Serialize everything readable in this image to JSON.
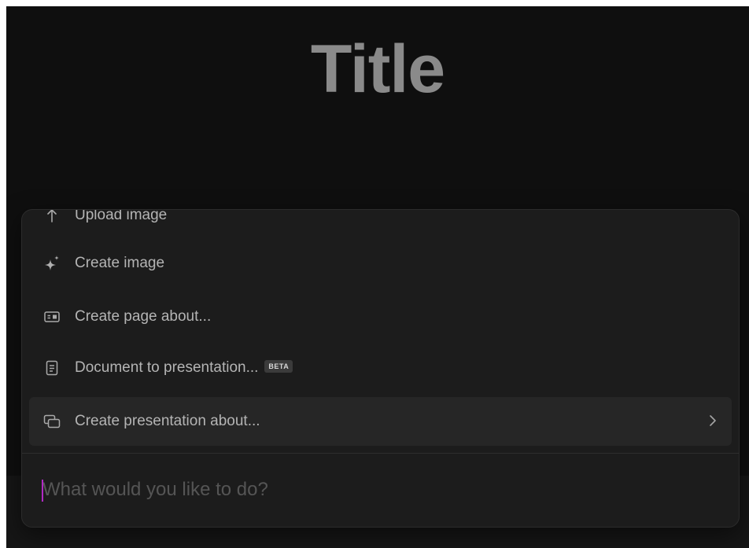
{
  "page": {
    "title": "Title"
  },
  "menu": {
    "items": [
      {
        "label": "Upload image",
        "icon": "upload-icon"
      },
      {
        "label": "Create image",
        "icon": "sparkle-icon"
      },
      {
        "label": "Create page about...",
        "icon": "page-card-icon"
      },
      {
        "label": "Document to presentation...",
        "icon": "document-icon",
        "badge": "BETA"
      },
      {
        "label": "Create presentation about...",
        "icon": "slides-icon",
        "active": true,
        "chevron": "chevron-right-icon"
      }
    ]
  },
  "prompt": {
    "placeholder": "What would you like to do?",
    "value": ""
  },
  "colors": {
    "background": "#0f0f0f",
    "panel": "#1c1c1c",
    "active_item": "#262626",
    "caret": "#b12ac4"
  }
}
